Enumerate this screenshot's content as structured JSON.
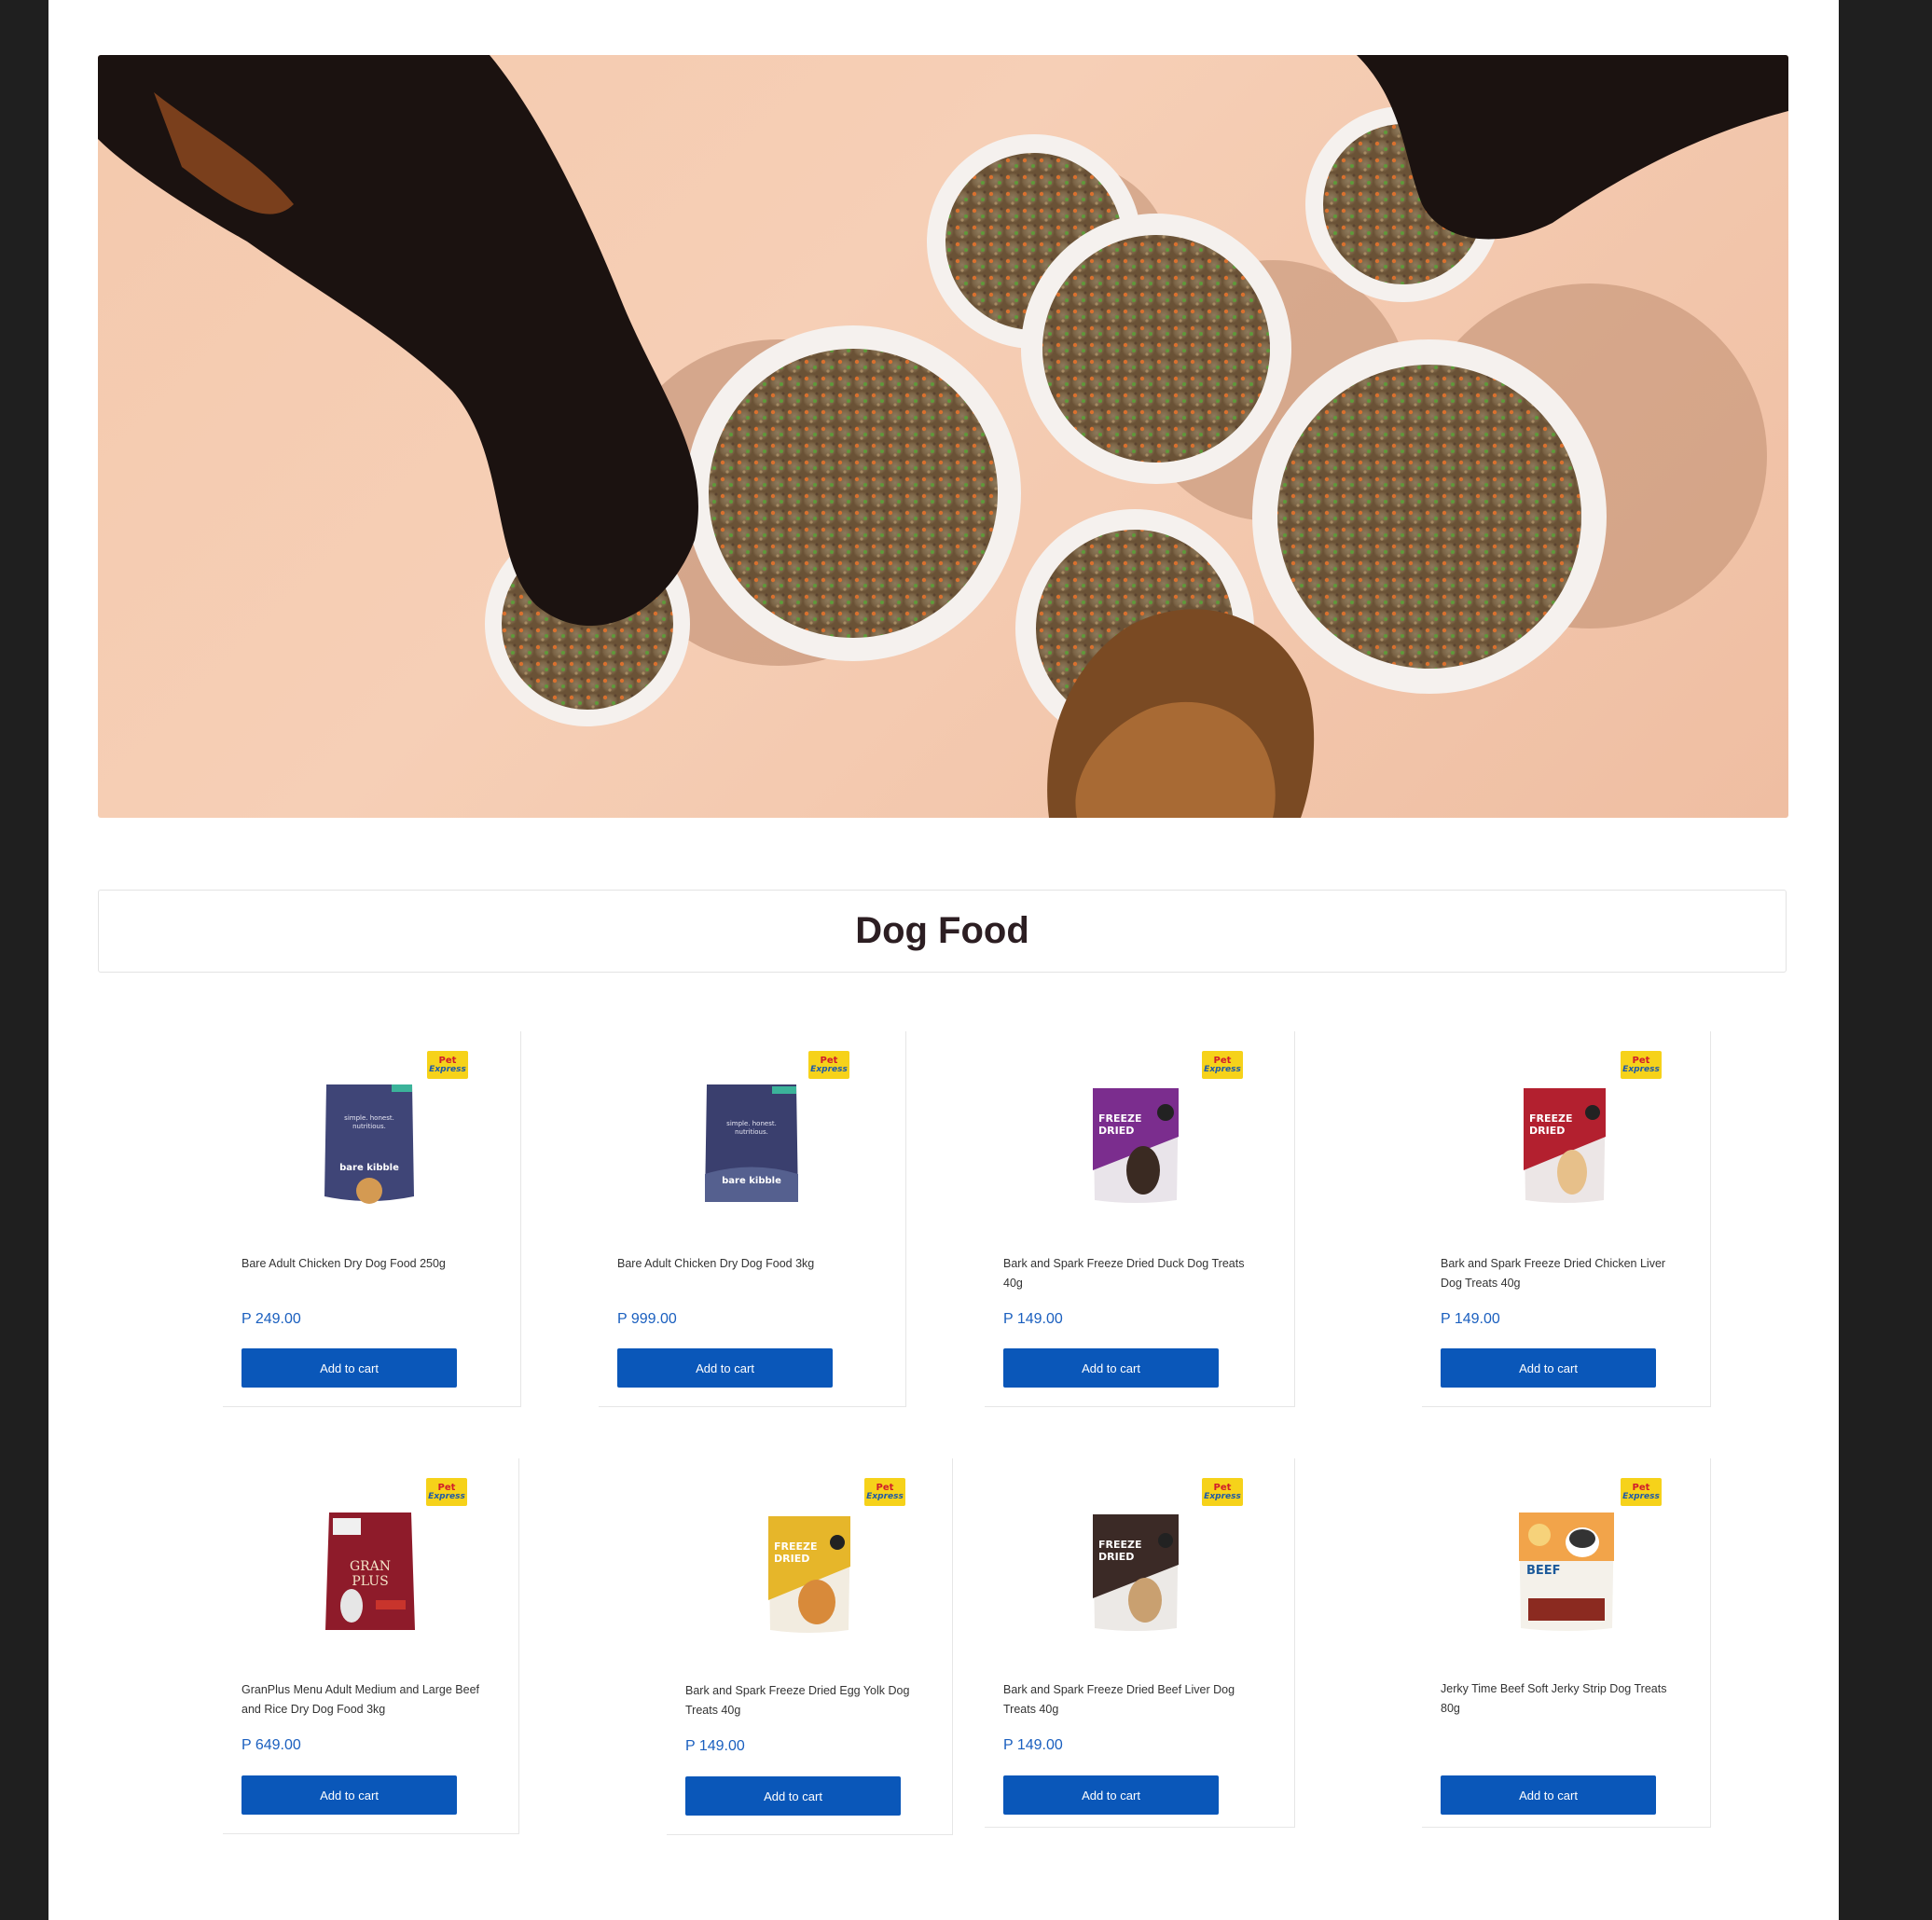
{
  "hero": {
    "alt": "Dogs eating from bowls of food"
  },
  "page_title": "Dog Food",
  "currency_symbol": "P",
  "badge": {
    "line1": "Pet",
    "line2": "Express"
  },
  "products": [
    {
      "name": "Bare Adult Chicken Dry Dog Food 250g",
      "price": "P 249.00",
      "button": "Add to cart",
      "pack_color": "#3f4577",
      "pack_accent": "#5d6598",
      "pack_text": "simple. honest. nutritious."
    },
    {
      "name": "Bare Adult Chicken Dry Dog Food 3kg",
      "price": "P 999.00",
      "button": "Add to cart",
      "pack_color": "#3a3f6e",
      "pack_accent": "#55608f",
      "pack_text": "simple. honest. nutritious."
    },
    {
      "name": "Bark and Spark Freeze Dried Duck Dog Treats 40g",
      "price": "P 149.00",
      "button": "Add to cart",
      "pack_color": "#7b2d8e",
      "pack_accent": "#e9e4ea",
      "pack_text": "FREEZE DRIED"
    },
    {
      "name": "Bark and Spark Freeze Dried Chicken Liver Dog Treats 40g",
      "price": "P 149.00",
      "button": "Add to cart",
      "pack_color": "#b3202f",
      "pack_accent": "#ece6e6",
      "pack_text": "FREEZE DRIED"
    },
    {
      "name": "GranPlus Menu Adult Medium and Large Beef and Rice Dry Dog Food 3kg",
      "price": "P 649.00",
      "button": "Add to cart",
      "pack_color": "#8e1b2a",
      "pack_accent": "#a52a37",
      "pack_text": "GRAN PLUS"
    },
    {
      "name": "Bark and Spark Freeze Dried Egg Yolk Dog Treats 40g",
      "price": "P 149.00",
      "button": "Add to cart",
      "pack_color": "#e6b62a",
      "pack_accent": "#f2ece0",
      "pack_text": "FREEZE DRIED"
    },
    {
      "name": "Bark and Spark Freeze Dried Beef Liver Dog Treats 40g",
      "price": "P 149.00",
      "button": "Add to cart",
      "pack_color": "#3b2a26",
      "pack_accent": "#ece9e6",
      "pack_text": "FREEZE DRIED"
    },
    {
      "name": "Jerky Time Beef Soft Jerky Strip Dog Treats 80g",
      "price": "",
      "button": "Add to cart",
      "pack_color": "#f2a44a",
      "pack_accent": "#f4f1ea",
      "pack_text": "BEEF"
    }
  ]
}
